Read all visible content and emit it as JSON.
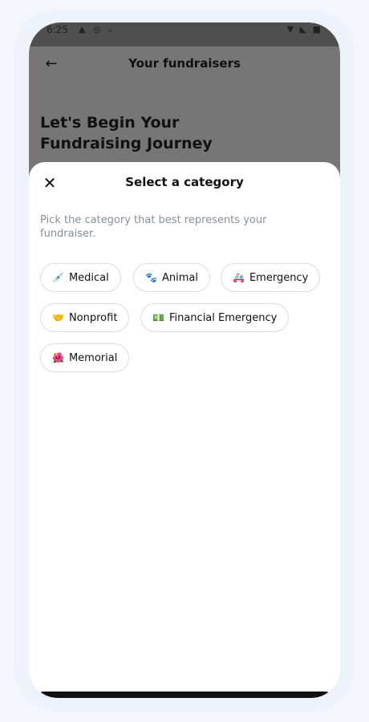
{
  "status_bar": {
    "time": "6:25",
    "left_icons": "▲ ◎ ₀",
    "right_icons": "▼ ◣ ■"
  },
  "header": {
    "title": "Your fundraisers",
    "hero_title": "Let's Begin Your Fundraising Journey",
    "back_glyph": "←"
  },
  "sheet": {
    "title": "Select a category",
    "close_glyph": "✕",
    "description": "Pick the category that best represents your fundraiser.",
    "categories": [
      {
        "label": "Medical",
        "emoji": "💉"
      },
      {
        "label": "Animal",
        "emoji": "🐾"
      },
      {
        "label": "Emergency",
        "emoji": "🚑"
      },
      {
        "label": "Nonprofit",
        "emoji": "🤝"
      },
      {
        "label": "Financial Emergency",
        "emoji": "💵"
      },
      {
        "label": "Memorial",
        "emoji": "🌺"
      }
    ]
  }
}
